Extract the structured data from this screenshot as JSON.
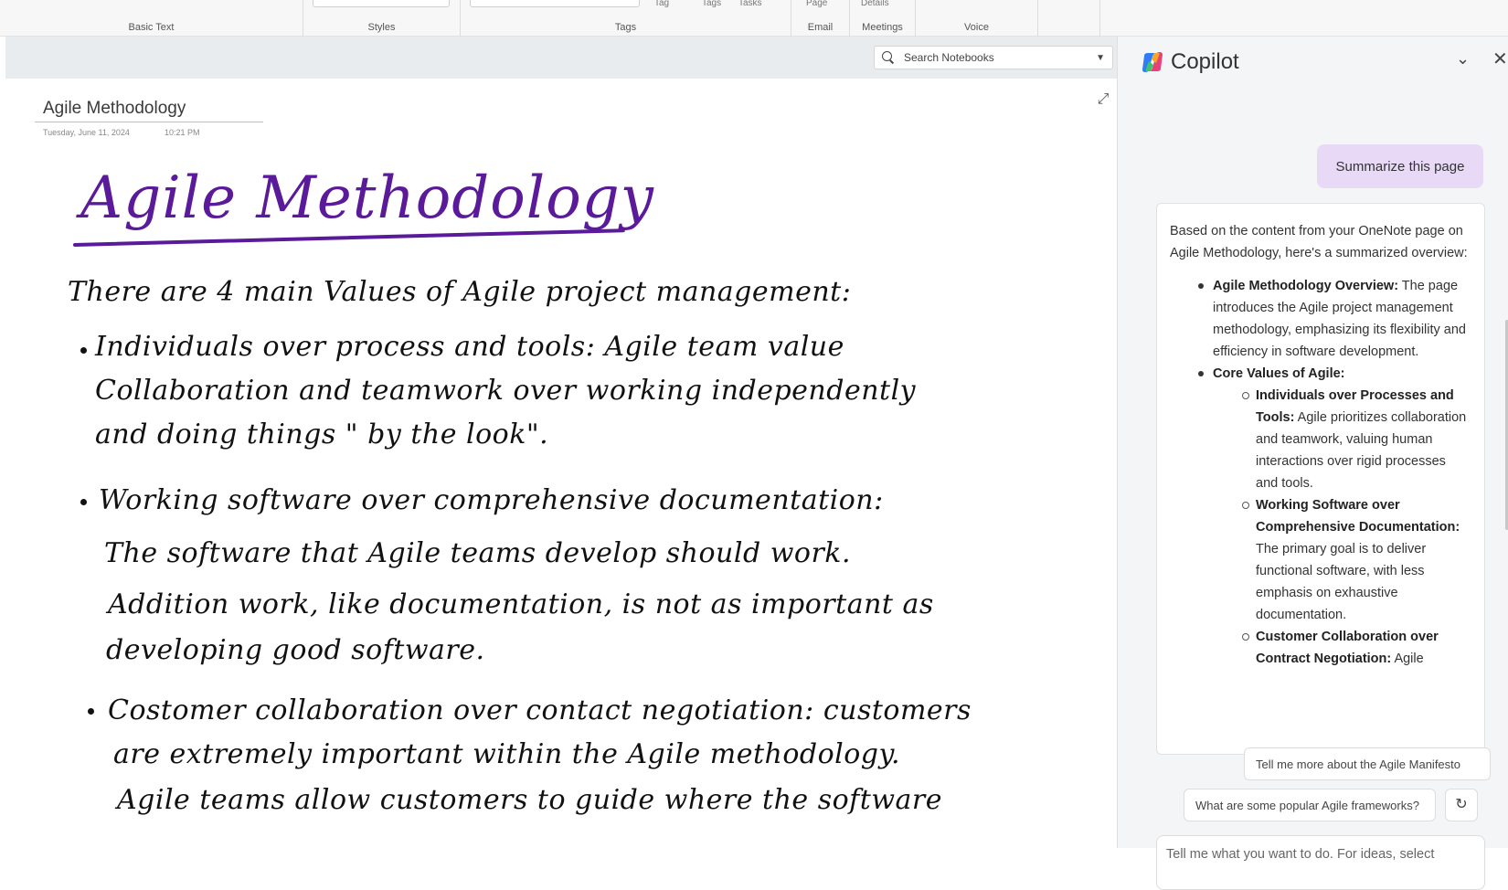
{
  "ribbon": {
    "groups": [
      "Basic Text",
      "Styles",
      "Tags",
      "Email",
      "Meetings",
      "Voice"
    ],
    "faint_labels": [
      "Tag",
      "Tags",
      "Tasks",
      "Page",
      "Details"
    ]
  },
  "note": {
    "search_placeholder": "Search Notebooks",
    "page_title": "Agile Methodology",
    "page_date": "Tuesday, June 11, 2024",
    "page_time": "10:21 PM",
    "handwritten_title": "Agile Methodology",
    "lines": [
      "There are 4 main Values of Agile project management:",
      "Individuals over process and tools: Agile team value",
      "Collaboration and teamwork over working independently",
      "and doing things \" by the look\".",
      "Working software over comprehensive documentation:",
      "The software that Agile teams develop should work.",
      "Addition work, like documentation, is not as important as",
      "developing good software.",
      "Costomer collaboration over contact negotiation: customers",
      "are extremely important within the Agile methodology.",
      "Agile teams allow customers to guide where the software"
    ]
  },
  "copilot": {
    "title": "Copilot",
    "user_message": "Summarize this page",
    "intro": "Based on the content from your OneNote page on Agile Methodology, here's a summarized overview:",
    "overview_bold": "Agile Methodology Overview:",
    "overview_text": " The page introduces the Agile project management methodology, emphasizing its flexibility and efficiency in software development.",
    "core_bold": "Core Values of Agile:",
    "values": [
      {
        "bold": "Individuals over Processes and Tools:",
        "text": " Agile prioritizes collaboration and teamwork, valuing human interactions over rigid processes and tools."
      },
      {
        "bold": "Working Software over Comprehensive Documentation:",
        "text": " The primary goal is to deliver functional software, with less emphasis on exhaustive documentation."
      },
      {
        "bold": "Customer Collaboration over Contract Negotiation:",
        "text": " Agile"
      }
    ],
    "suggestions": [
      "Tell me more about the Agile Manifesto",
      "What are some popular Agile frameworks?"
    ],
    "composer_placeholder": "Tell me what you want to do. For ideas, select"
  }
}
